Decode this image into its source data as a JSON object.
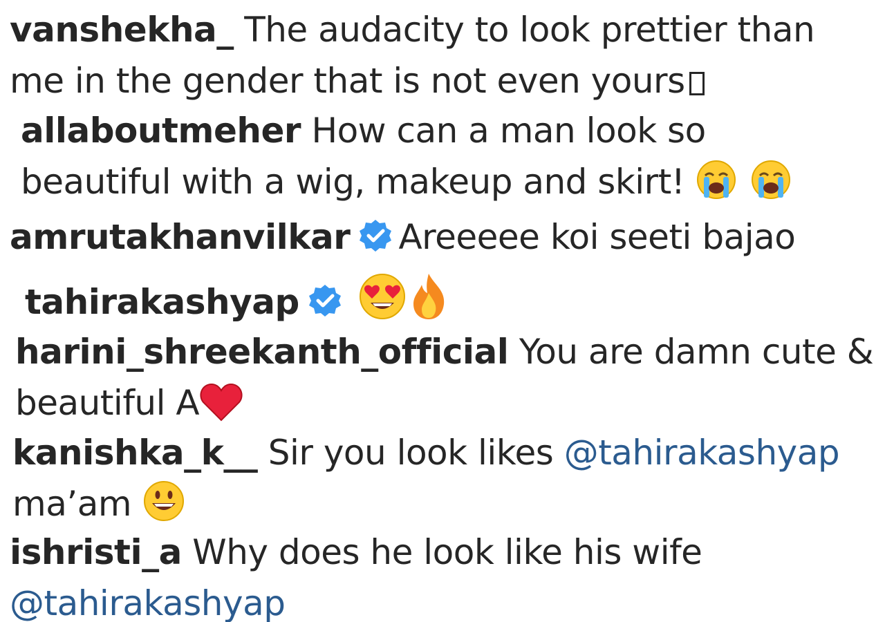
{
  "comments": [
    {
      "username": "vanshekha_",
      "text": "The audacity to look prettier than me in the gender that is not even yours"
    },
    {
      "username": "allaboutmeher",
      "text": "How can a man look so beautiful with a wig, makeup and skirt!",
      "emojis": [
        "loudly-crying-face",
        "loudly-crying-face"
      ]
    },
    {
      "username": "amrutakhanvilkar",
      "verified": true,
      "text": "Areeeee koi seeti bajao"
    },
    {
      "username": "tahirakashyap",
      "verified": true,
      "emojis": [
        "heart-eyes-face",
        "fire"
      ]
    },
    {
      "username": "harini_shreekanth_official",
      "text": "You are damn cute & beautiful A",
      "emojis": [
        "red-heart"
      ]
    },
    {
      "username": "kanishka_k__",
      "text": "Sir you look likes",
      "mention": "@tahirakashyap",
      "text_after": "ma’am",
      "emojis": [
        "grinning-face"
      ]
    },
    {
      "username": "ishristi_a",
      "text": "Why does he look like his wife",
      "mention": "@tahirakashyap"
    }
  ],
  "colors": {
    "text": "#262626",
    "mention": "#2b5b8f",
    "verified": "#3897f0"
  }
}
